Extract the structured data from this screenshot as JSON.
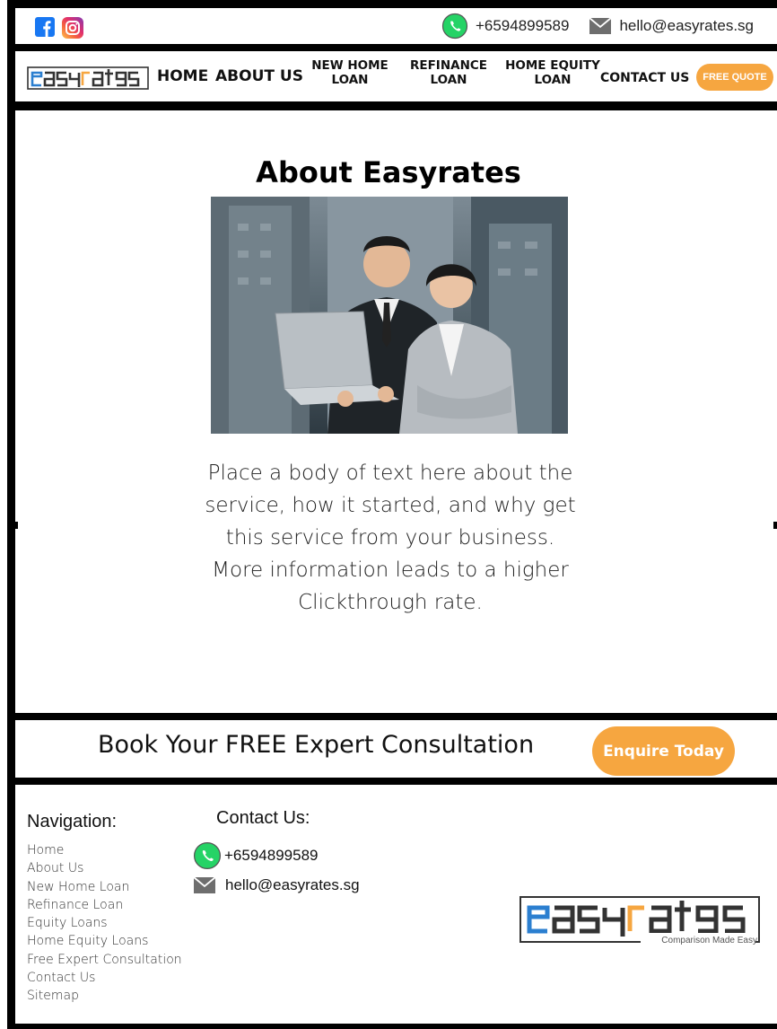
{
  "topbar": {
    "social": [
      "facebook-icon",
      "instagram-icon"
    ],
    "phone": "+6594899589",
    "email": "hello@easyrates.sg"
  },
  "brand": {
    "name": "easyrates",
    "tagline": "Comparison Made Easy",
    "colors": {
      "blue": "#2b7fd0",
      "orange": "#f6a640",
      "dark": "#333333"
    }
  },
  "nav": {
    "home": "HOME",
    "about": "ABOUT US",
    "new_home_loan": [
      "NEW HOME",
      "LOAN"
    ],
    "refinance_loan": [
      "REFINANCE",
      "LOAN"
    ],
    "home_equity_loan": [
      "HOME EQUITY",
      "LOAN"
    ],
    "contact": "CONTACT US",
    "quote": "FREE QUOTE"
  },
  "main": {
    "title": "About Easyrates",
    "body": "Place a body of text here about the service, how it started, and why get this service from your business. More information leads to a higher Clickthrough rate."
  },
  "cta": {
    "text": "Book Your FREE Expert Consultation",
    "button": "Enquire Today"
  },
  "footer": {
    "nav_title": "Navigation:",
    "nav_items": [
      "Home",
      "About Us",
      "New Home Loan",
      "Refinance Loan",
      "Equity Loans",
      "Home Equity Loans",
      "Free Expert Consultation",
      "Contact Us",
      "Sitemap"
    ],
    "contact_title": "Contact Us:",
    "phone": "+6594899589",
    "email": "hello@easyrates.sg"
  }
}
